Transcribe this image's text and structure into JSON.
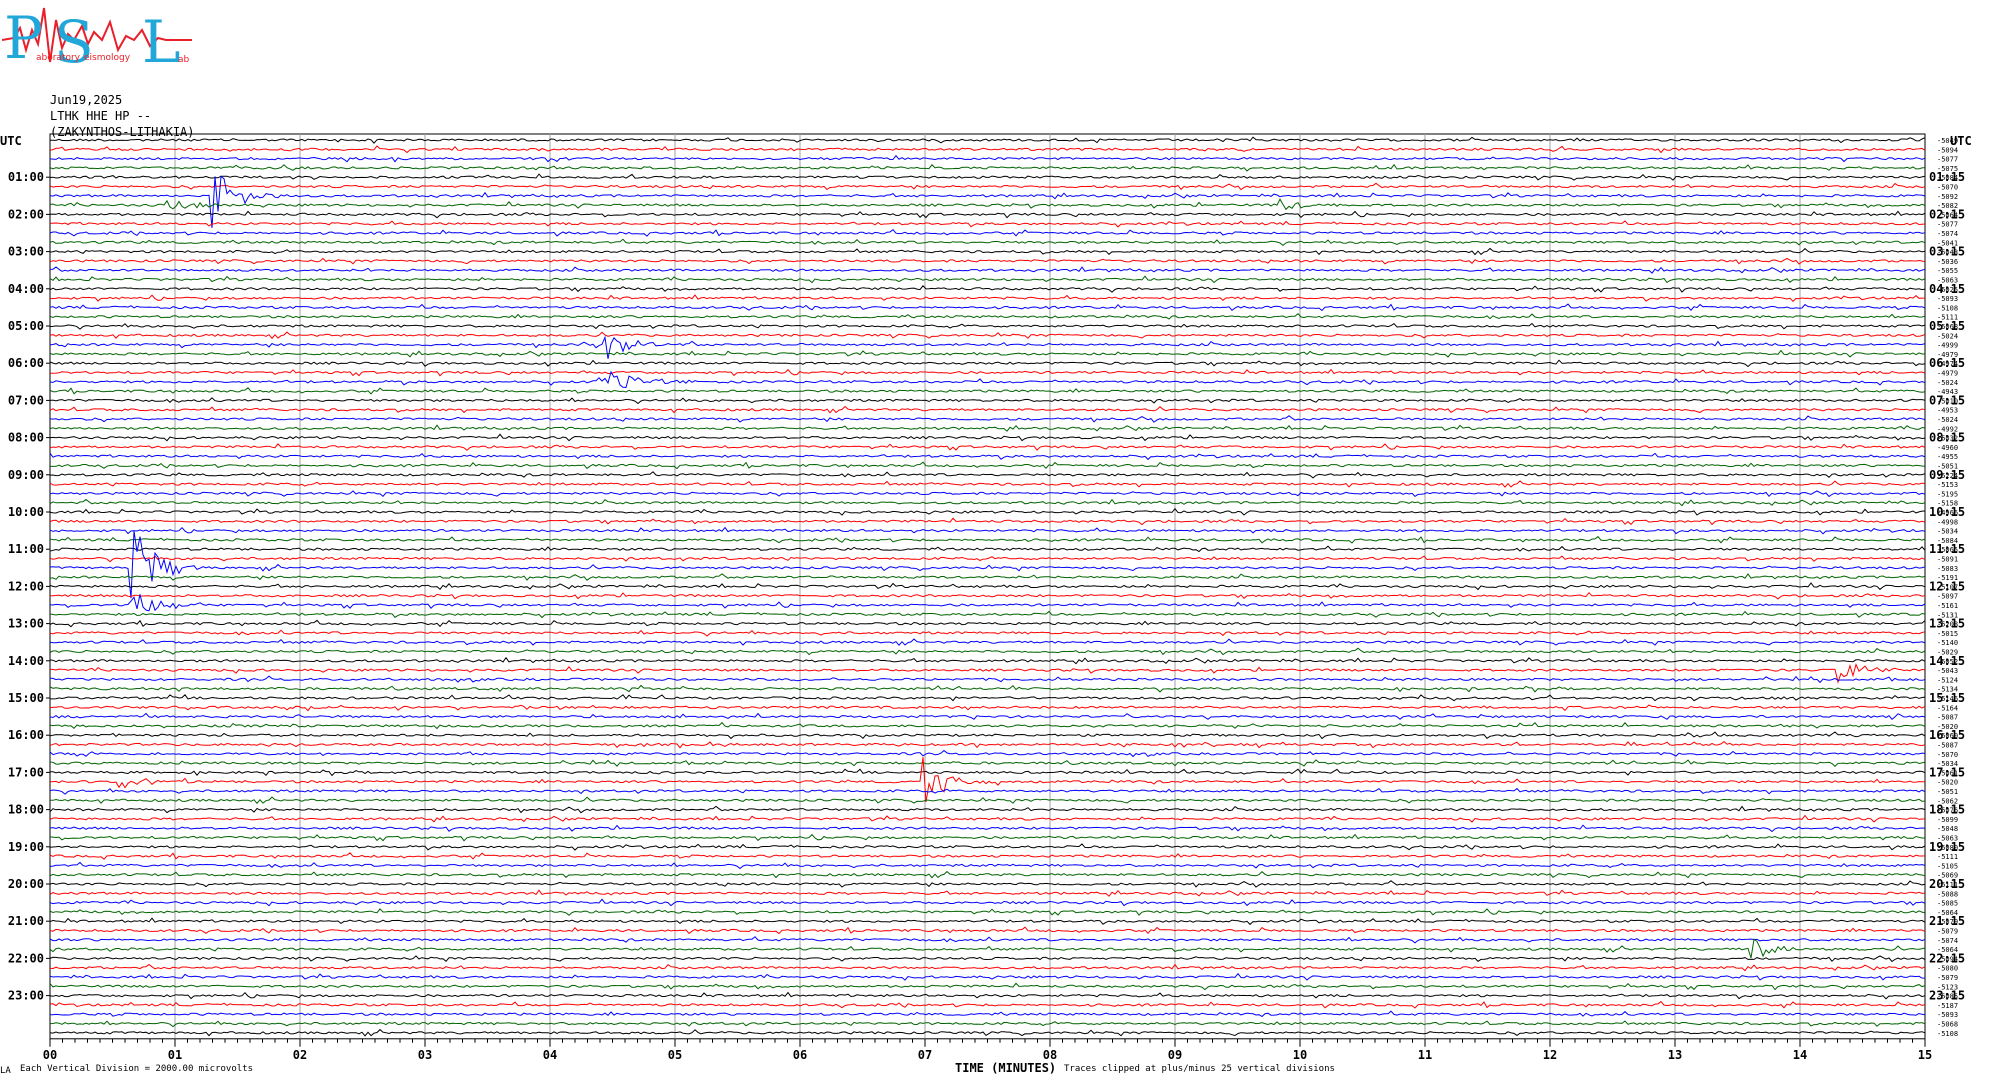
{
  "logo": {
    "letters": [
      "P",
      "S",
      "L"
    ],
    "small_words": [
      "aboratory",
      "eismology",
      "ab"
    ],
    "colors": {
      "letters": "#22a7d9",
      "trace": "#e8202a"
    }
  },
  "header": {
    "date": "Jun19,2025",
    "station": "LTHK HHE HP --",
    "location": "(ZAKYNTHOS-LITHAKIA)"
  },
  "axes": {
    "utc_left": "UTC",
    "utc_right": "UTC",
    "x_title": "TIME (MINUTES)",
    "scale_note": "Each Vertical Division = 2000.00 microvolts",
    "clip_note": "Traces clipped at plus/minus 25 vertical divisions",
    "corner_mark": "LA"
  },
  "chart_data": {
    "type": "line",
    "subtype": "helicorder",
    "x": {
      "label": "TIME (MINUTES)",
      "range": [
        0,
        15
      ],
      "ticks": [
        "00",
        "01",
        "02",
        "03",
        "04",
        "05",
        "06",
        "07",
        "08",
        "09",
        "10",
        "11",
        "12",
        "13",
        "14",
        "15"
      ]
    },
    "left_hour_labels": [
      "01:00",
      "02:00",
      "03:00",
      "04:00",
      "05:00",
      "06:00",
      "07:00",
      "08:00",
      "09:00",
      "10:00",
      "11:00",
      "12:00",
      "13:00",
      "14:00",
      "15:00",
      "16:00",
      "17:00",
      "18:00",
      "19:00",
      "20:00",
      "21:00",
      "22:00",
      "23:00"
    ],
    "right_hour_labels": [
      "01:15",
      "02:15",
      "03:15",
      "04:15",
      "05:15",
      "06:15",
      "07:15",
      "08:15",
      "09:15",
      "10:15",
      "11:15",
      "12:15",
      "13:15",
      "14:15",
      "15:15",
      "16:15",
      "17:15",
      "18:15",
      "19:15",
      "20:15",
      "21:15",
      "22:15",
      "23:15"
    ],
    "trace_colors": [
      "#000000",
      "#ff0000",
      "#0000ff",
      "#006400"
    ],
    "trace_offsets": [
      "-5049",
      "-5094",
      "-5077",
      "-5075",
      "-5084",
      "-5070",
      "-5092",
      "-5082",
      "-5064",
      "-5077",
      "-5074",
      "-5041",
      "-5043",
      "-5036",
      "-5055",
      "-5063",
      "-5025",
      "-5093",
      "-5108",
      "-5111",
      "-5068",
      "-5024",
      "-4999",
      "-4979",
      "-4974",
      "-4979",
      "-5024",
      "-4943",
      "-5010",
      "-4953",
      "-5024",
      "-4992",
      "-5032",
      "-4960",
      "-4955",
      "-5051",
      "-5224",
      "-5153",
      "-5195",
      "-5158",
      "-4966",
      "-4998",
      "-5034",
      "-5084",
      "-5065",
      "-5091",
      "-5083",
      "-5191",
      "-5107",
      "-5097",
      "-5161",
      "-5131",
      "-5208",
      "-5015",
      "-5140",
      "-5029",
      "-5052",
      "-5043",
      "-5124",
      "-5134",
      "-5146",
      "-5164",
      "-5087",
      "-5020",
      "-5060",
      "-5087",
      "-5070",
      "-5034",
      "-5061",
      "-5020",
      "-5051",
      "-5062",
      "-5076",
      "-5099",
      "-5048",
      "-5063",
      "-5080",
      "-5111",
      "-5105",
      "-5069",
      "-5111",
      "-5088",
      "-5085",
      "-5064",
      "-5079",
      "-5079",
      "-5074",
      "-5064",
      "-5094",
      "-5080",
      "-5079",
      "-5123",
      "-5085",
      "-5187",
      "-5093",
      "-5068",
      "-5108"
    ],
    "scale_microvolts_per_division": 2000.0,
    "clip_divisions": 25,
    "events": [
      {
        "trace": 7,
        "minute": 0.95,
        "amp": 0.9
      },
      {
        "trace": 6,
        "minute": 1.3,
        "amp": 3.5
      },
      {
        "trace": 7,
        "minute": 9.85,
        "amp": 0.8
      },
      {
        "trace": 22,
        "minute": 4.45,
        "amp": 1.8
      },
      {
        "trace": 26,
        "minute": 4.4,
        "amp": 0.8
      },
      {
        "trace": 26,
        "minute": 4.5,
        "amp": 1.2
      },
      {
        "trace": 46,
        "minute": 0.65,
        "amp": 5.0
      },
      {
        "trace": 50,
        "minute": 0.65,
        "amp": 2.0
      },
      {
        "trace": 57,
        "minute": 14.3,
        "amp": 1.5
      },
      {
        "trace": 69,
        "minute": 7.0,
        "amp": 2.5
      },
      {
        "trace": 69,
        "minute": 0.55,
        "amp": 1.0
      },
      {
        "trace": 87,
        "minute": 13.6,
        "amp": 1.5
      }
    ]
  }
}
